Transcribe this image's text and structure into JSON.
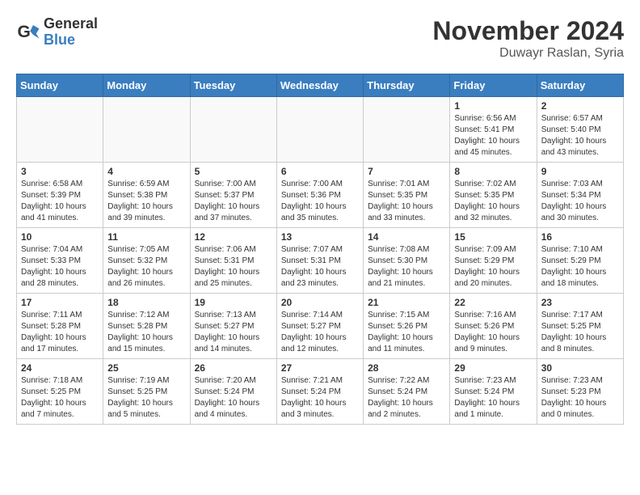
{
  "logo": {
    "line1": "General",
    "line2": "Blue"
  },
  "title": "November 2024",
  "subtitle": "Duwayr Raslan, Syria",
  "weekdays": [
    "Sunday",
    "Monday",
    "Tuesday",
    "Wednesday",
    "Thursday",
    "Friday",
    "Saturday"
  ],
  "weeks": [
    [
      {
        "day": "",
        "info": ""
      },
      {
        "day": "",
        "info": ""
      },
      {
        "day": "",
        "info": ""
      },
      {
        "day": "",
        "info": ""
      },
      {
        "day": "",
        "info": ""
      },
      {
        "day": "1",
        "info": "Sunrise: 6:56 AM\nSunset: 5:41 PM\nDaylight: 10 hours\nand 45 minutes."
      },
      {
        "day": "2",
        "info": "Sunrise: 6:57 AM\nSunset: 5:40 PM\nDaylight: 10 hours\nand 43 minutes."
      }
    ],
    [
      {
        "day": "3",
        "info": "Sunrise: 6:58 AM\nSunset: 5:39 PM\nDaylight: 10 hours\nand 41 minutes."
      },
      {
        "day": "4",
        "info": "Sunrise: 6:59 AM\nSunset: 5:38 PM\nDaylight: 10 hours\nand 39 minutes."
      },
      {
        "day": "5",
        "info": "Sunrise: 7:00 AM\nSunset: 5:37 PM\nDaylight: 10 hours\nand 37 minutes."
      },
      {
        "day": "6",
        "info": "Sunrise: 7:00 AM\nSunset: 5:36 PM\nDaylight: 10 hours\nand 35 minutes."
      },
      {
        "day": "7",
        "info": "Sunrise: 7:01 AM\nSunset: 5:35 PM\nDaylight: 10 hours\nand 33 minutes."
      },
      {
        "day": "8",
        "info": "Sunrise: 7:02 AM\nSunset: 5:35 PM\nDaylight: 10 hours\nand 32 minutes."
      },
      {
        "day": "9",
        "info": "Sunrise: 7:03 AM\nSunset: 5:34 PM\nDaylight: 10 hours\nand 30 minutes."
      }
    ],
    [
      {
        "day": "10",
        "info": "Sunrise: 7:04 AM\nSunset: 5:33 PM\nDaylight: 10 hours\nand 28 minutes."
      },
      {
        "day": "11",
        "info": "Sunrise: 7:05 AM\nSunset: 5:32 PM\nDaylight: 10 hours\nand 26 minutes."
      },
      {
        "day": "12",
        "info": "Sunrise: 7:06 AM\nSunset: 5:31 PM\nDaylight: 10 hours\nand 25 minutes."
      },
      {
        "day": "13",
        "info": "Sunrise: 7:07 AM\nSunset: 5:31 PM\nDaylight: 10 hours\nand 23 minutes."
      },
      {
        "day": "14",
        "info": "Sunrise: 7:08 AM\nSunset: 5:30 PM\nDaylight: 10 hours\nand 21 minutes."
      },
      {
        "day": "15",
        "info": "Sunrise: 7:09 AM\nSunset: 5:29 PM\nDaylight: 10 hours\nand 20 minutes."
      },
      {
        "day": "16",
        "info": "Sunrise: 7:10 AM\nSunset: 5:29 PM\nDaylight: 10 hours\nand 18 minutes."
      }
    ],
    [
      {
        "day": "17",
        "info": "Sunrise: 7:11 AM\nSunset: 5:28 PM\nDaylight: 10 hours\nand 17 minutes."
      },
      {
        "day": "18",
        "info": "Sunrise: 7:12 AM\nSunset: 5:28 PM\nDaylight: 10 hours\nand 15 minutes."
      },
      {
        "day": "19",
        "info": "Sunrise: 7:13 AM\nSunset: 5:27 PM\nDaylight: 10 hours\nand 14 minutes."
      },
      {
        "day": "20",
        "info": "Sunrise: 7:14 AM\nSunset: 5:27 PM\nDaylight: 10 hours\nand 12 minutes."
      },
      {
        "day": "21",
        "info": "Sunrise: 7:15 AM\nSunset: 5:26 PM\nDaylight: 10 hours\nand 11 minutes."
      },
      {
        "day": "22",
        "info": "Sunrise: 7:16 AM\nSunset: 5:26 PM\nDaylight: 10 hours\nand 9 minutes."
      },
      {
        "day": "23",
        "info": "Sunrise: 7:17 AM\nSunset: 5:25 PM\nDaylight: 10 hours\nand 8 minutes."
      }
    ],
    [
      {
        "day": "24",
        "info": "Sunrise: 7:18 AM\nSunset: 5:25 PM\nDaylight: 10 hours\nand 7 minutes."
      },
      {
        "day": "25",
        "info": "Sunrise: 7:19 AM\nSunset: 5:25 PM\nDaylight: 10 hours\nand 5 minutes."
      },
      {
        "day": "26",
        "info": "Sunrise: 7:20 AM\nSunset: 5:24 PM\nDaylight: 10 hours\nand 4 minutes."
      },
      {
        "day": "27",
        "info": "Sunrise: 7:21 AM\nSunset: 5:24 PM\nDaylight: 10 hours\nand 3 minutes."
      },
      {
        "day": "28",
        "info": "Sunrise: 7:22 AM\nSunset: 5:24 PM\nDaylight: 10 hours\nand 2 minutes."
      },
      {
        "day": "29",
        "info": "Sunrise: 7:23 AM\nSunset: 5:24 PM\nDaylight: 10 hours\nand 1 minute."
      },
      {
        "day": "30",
        "info": "Sunrise: 7:23 AM\nSunset: 5:23 PM\nDaylight: 10 hours\nand 0 minutes."
      }
    ]
  ]
}
